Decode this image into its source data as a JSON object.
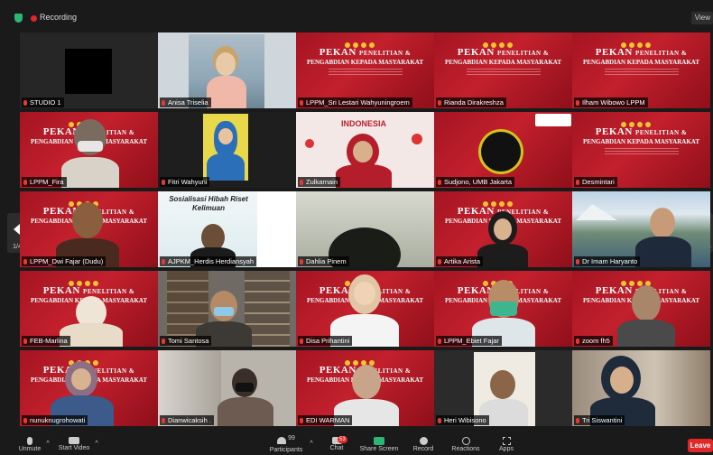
{
  "topbar": {
    "recording_label": "Recording",
    "view_label": "View"
  },
  "nav": {
    "page_left": "1/4",
    "page_right": "1/4"
  },
  "poster": {
    "title_big": "PEKAN",
    "title_small": "PENELITIAN &",
    "subtitle": "PENGABDIAN KEPADA MASYARAKAT"
  },
  "tiles": [
    {
      "name": "STUDIO 1"
    },
    {
      "name": "Anisa Triselia"
    },
    {
      "name": "LPPM_Sri Lestari Wahyuningroem"
    },
    {
      "name": "Rianda Dirakreshza"
    },
    {
      "name": "Ilham Wibowo LPPM"
    },
    {
      "name": "LPPM_Fira"
    },
    {
      "name": "Fitri Wahyuni"
    },
    {
      "name": "Zulkarnain",
      "banner": "INDONESIA"
    },
    {
      "name": "Sudjono, UMB Jakarta"
    },
    {
      "name": "Desmintari"
    },
    {
      "name": "LPPM_Dwi Fajar (Dudu)"
    },
    {
      "name": "AJPKM_Herdis Herdiansyah",
      "slide_title": "Sosialisasi Hibah Riset Kelimuan"
    },
    {
      "name": "Dahlia Pinem"
    },
    {
      "name": "Artika Arista"
    },
    {
      "name": "Dr Imam Haryanto"
    },
    {
      "name": "FEB-Marlina"
    },
    {
      "name": "Tomi Santosa"
    },
    {
      "name": "Disa Prihantini"
    },
    {
      "name": "LPPM_Ebiet Fajar"
    },
    {
      "name": "zoom fh5"
    },
    {
      "name": "nunuknugrohowati"
    },
    {
      "name": "Dianwicaksih ."
    },
    {
      "name": "EDI WARMAN"
    },
    {
      "name": "Heri Wibisono"
    },
    {
      "name": "Tri Siswantini"
    }
  ],
  "toolbar": {
    "unmute": "Unmute",
    "start_video": "Start Video",
    "participants": "Participants",
    "participants_count": "99",
    "chat": "Chat",
    "chat_badge": "53",
    "share_screen": "Share Screen",
    "record": "Record",
    "reactions": "Reactions",
    "apps": "Apps",
    "leave": "Leave"
  },
  "colors": {
    "accent_green": "#2bb673",
    "record_red": "#e02828",
    "active_border": "#b8d432",
    "poster_red": "#b81a26"
  }
}
